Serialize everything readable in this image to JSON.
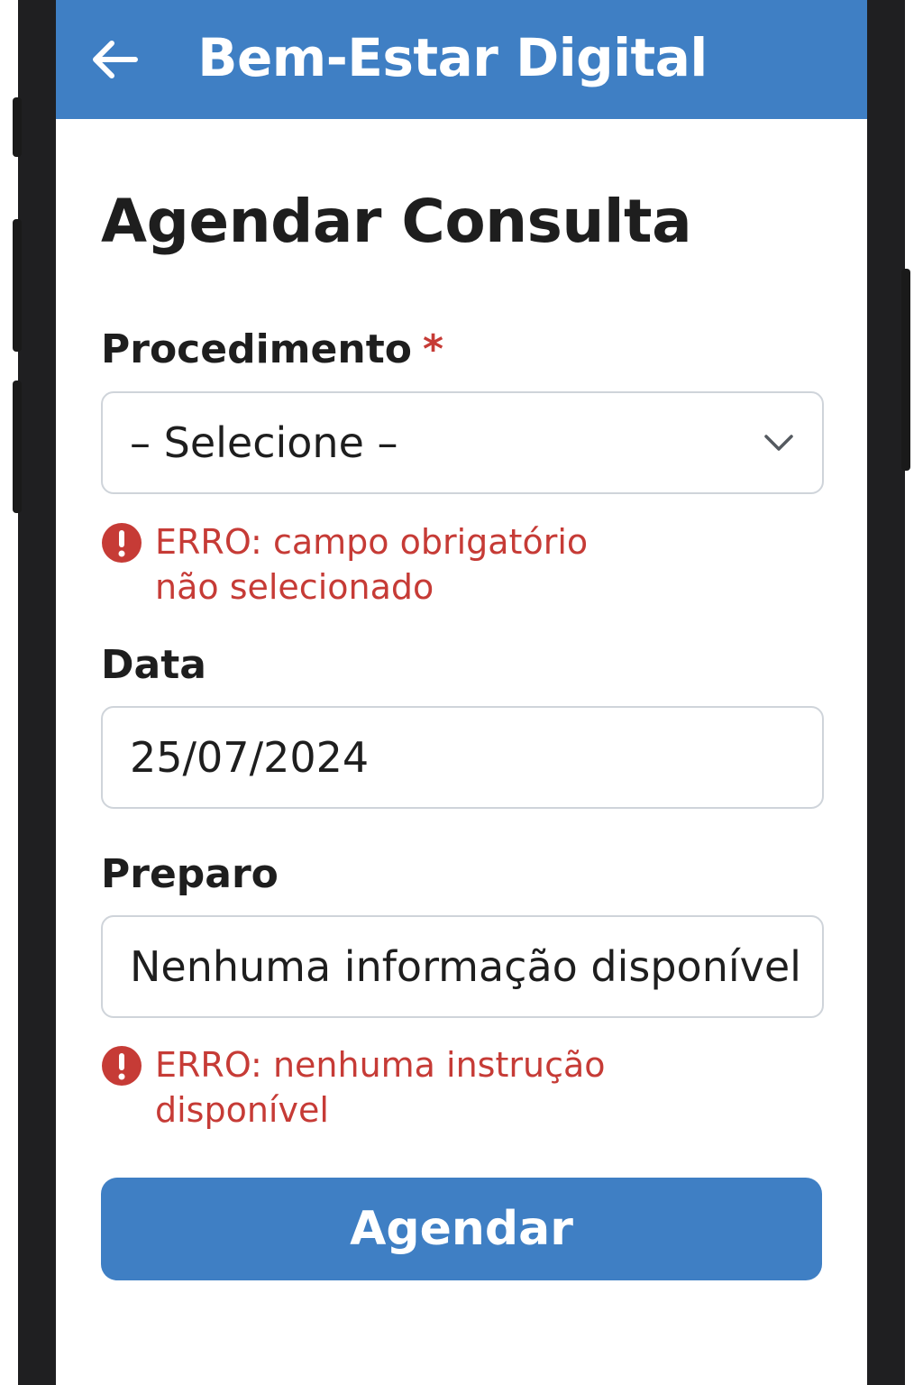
{
  "header": {
    "back_icon": "arrow-left-icon",
    "title": "Bem-Estar Digital"
  },
  "page": {
    "title": "Agendar Consulta"
  },
  "form": {
    "procedimento": {
      "label": "Procedimento",
      "required_marker": "*",
      "selected_value": "– Selecione –",
      "dropdown_icon": "chevron-down-icon",
      "error_icon": "error-icon",
      "error_line1": "ERRO: campo obrigatório",
      "error_line2": "não selecionado"
    },
    "data": {
      "label": "Data",
      "value": "25/07/2024"
    },
    "preparo": {
      "label": "Preparo",
      "value": "Nenhuma informação disponível",
      "error_icon": "error-icon",
      "error_line1": "ERRO: nenhuma instrução",
      "error_line2": "disponível"
    },
    "submit_label": "Agendar"
  },
  "colors": {
    "primary": "#3f7fc4",
    "error": "#c63b36",
    "text": "#1e1e1e",
    "border": "#cfd4da"
  }
}
